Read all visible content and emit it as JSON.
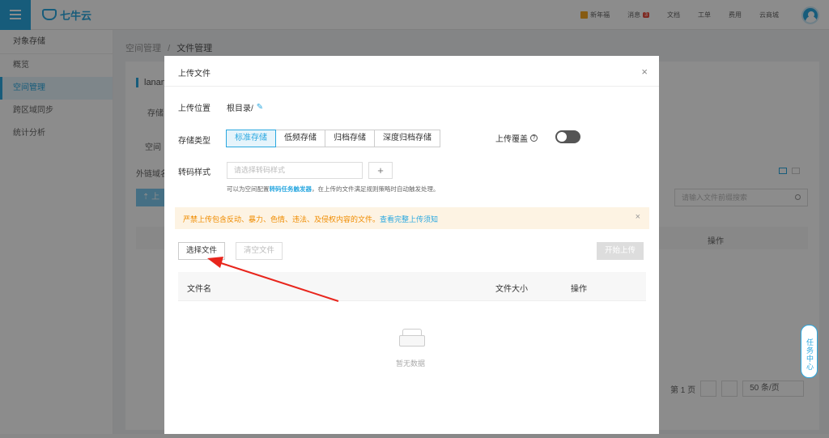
{
  "topbar": {
    "logo_text": "七牛云",
    "nav": [
      {
        "label": "新年福",
        "type": "gift"
      },
      {
        "label": "消息",
        "badge": "3"
      },
      {
        "label": "文档"
      },
      {
        "label": "工单"
      },
      {
        "label": "费用"
      },
      {
        "label": "云商城"
      }
    ]
  },
  "sidebar": {
    "items": [
      {
        "label": "对象存储"
      },
      {
        "label": "概览"
      },
      {
        "label": "空间管理",
        "active": true
      },
      {
        "label": "跨区域同步"
      },
      {
        "label": "统计分析"
      }
    ]
  },
  "breadcrumb": {
    "parent": "空间管理",
    "separator": "/",
    "current": "文件管理"
  },
  "background": {
    "bucket_name": "lanan",
    "label_storage": "存储",
    "label_space": "空间",
    "label_domain": "外链域名",
    "upload_btn": "上",
    "search_placeholder": "请输入文件前缀搜索",
    "col_op": "操作",
    "page_label": "第 1 页",
    "page_size": "50 条/页"
  },
  "task_center": "任务中心",
  "modal": {
    "title": "上传文件",
    "close": "×",
    "location_label": "上传位置",
    "location_value": "根目录/",
    "storage_label": "存储类型",
    "storage_types": [
      "标准存储",
      "低频存储",
      "归档存储",
      "深度归档存储"
    ],
    "storage_selected": "标准存储",
    "overwrite_label": "上传覆盖",
    "overwrite_on": false,
    "transcode_label": "转码样式",
    "transcode_placeholder": "请选择转码样式",
    "add_btn": "+",
    "hint_prefix": "可以为空间配置",
    "hint_link": "转码任务触发器",
    "hint_suffix": "，在上传的文件满足规则策略时自动触发处理。",
    "notice_text": "严禁上传包含反动、暴力、色情、违法、及侵权内容的文件。",
    "notice_link": "查看完整上传须知",
    "select_btn": "选择文件",
    "clear_btn": "清空文件",
    "start_btn": "开始上传",
    "table": {
      "col_name": "文件名",
      "col_size": "文件大小",
      "col_op": "操作"
    },
    "empty_text": "暂无数据"
  },
  "colors": {
    "accent": "#2ba8e0",
    "warning": "#f08c00",
    "annotation_arrow": "#e8251c"
  }
}
